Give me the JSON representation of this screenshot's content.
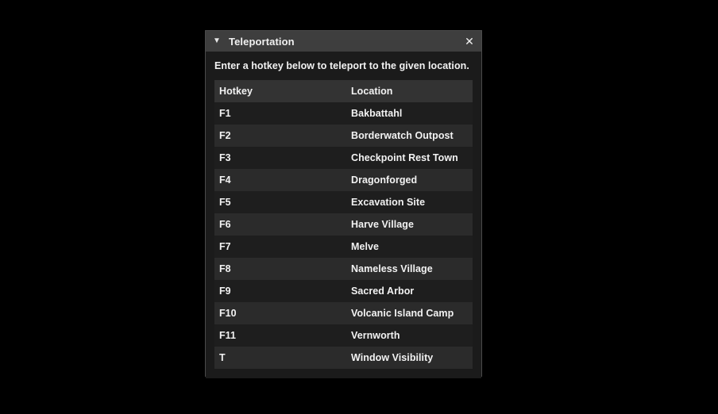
{
  "window": {
    "title": "Teleportation",
    "collapse_icon": "collapse-triangle-icon",
    "collapse_glyph": "▼",
    "close_icon": "close-icon",
    "close_glyph": "✕",
    "description": "Enter a hotkey below to teleport to the given location."
  },
  "table": {
    "columns": [
      "Hotkey",
      "Location"
    ],
    "rows": [
      {
        "hotkey": "F1",
        "location": "Bakbattahl"
      },
      {
        "hotkey": "F2",
        "location": "Borderwatch Outpost"
      },
      {
        "hotkey": "F3",
        "location": "Checkpoint Rest Town"
      },
      {
        "hotkey": "F4",
        "location": "Dragonforged"
      },
      {
        "hotkey": "F5",
        "location": "Excavation Site"
      },
      {
        "hotkey": "F6",
        "location": "Harve Village"
      },
      {
        "hotkey": "F7",
        "location": "Melve"
      },
      {
        "hotkey": "F8",
        "location": "Nameless Village"
      },
      {
        "hotkey": "F9",
        "location": "Sacred Arbor"
      },
      {
        "hotkey": "F10",
        "location": "Volcanic Island Camp"
      },
      {
        "hotkey": "F11",
        "location": "Vernworth"
      },
      {
        "hotkey": "T",
        "location": "Window Visibility"
      }
    ]
  },
  "colors": {
    "background": "#000000",
    "panel": "#1b1b1b",
    "panel_border": "#4a4a4a",
    "title_bar": "#3e3e3e",
    "header_row": "#333333",
    "row_odd": "#1e1e1e",
    "row_even": "#2b2b2b",
    "text": "#f2f2f2"
  }
}
